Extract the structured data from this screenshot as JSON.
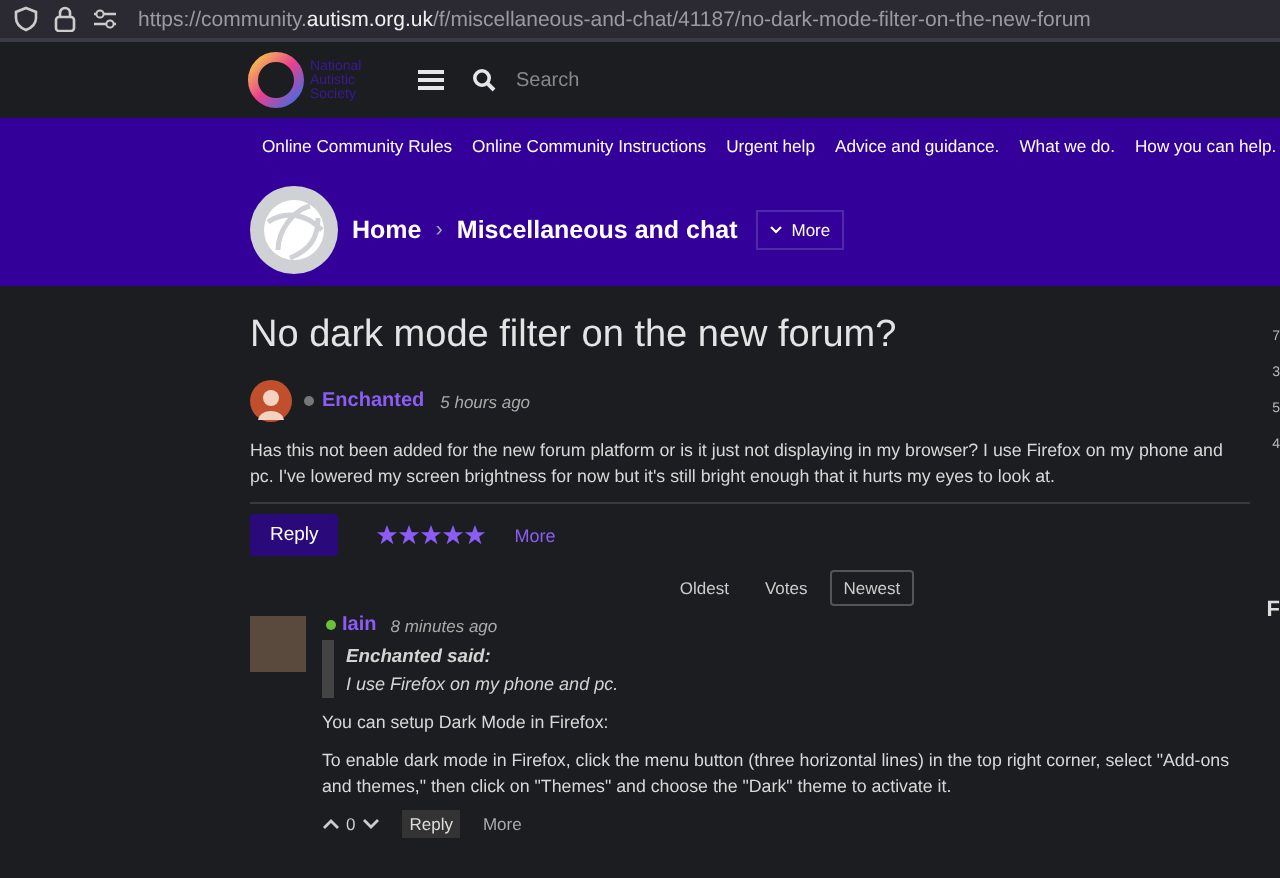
{
  "browser": {
    "url_prefix": "https://community.",
    "url_domain": "autism.org.uk",
    "url_path": "/f/miscellaneous-and-chat/41187/no-dark-mode-filter-on-the-new-forum"
  },
  "header": {
    "logo_text": "National Autistic Society",
    "search": {
      "placeholder": "Search"
    }
  },
  "nav": [
    "Online Community Rules",
    "Online Community Instructions",
    "Urgent help",
    "Advice and guidance.",
    "What we do.",
    "How you can help."
  ],
  "breadcrumb": {
    "items": [
      "Home",
      "Miscellaneous and chat"
    ],
    "separator": "›",
    "more": "More"
  },
  "post": {
    "title": "No dark mode filter on the new forum?",
    "author": "Enchanted",
    "online": false,
    "time": "5 hours ago",
    "body": "Has this not been added for the new forum platform or is it just not displaying in my browser? I use Firefox on my phone and pc. I've lowered my screen brightness for now but it's still bright enough that it hurts my eyes to look at.",
    "reply": "Reply",
    "stars": 5,
    "more": "More"
  },
  "sort_tabs": [
    {
      "label": "Oldest",
      "selected": false
    },
    {
      "label": "Votes",
      "selected": false
    },
    {
      "label": "Newest",
      "selected": true
    }
  ],
  "replies": [
    {
      "author": "Iain",
      "online": true,
      "time": "8 minutes ago",
      "quote_author": "Enchanted said:",
      "quote": "I use Firefox on my phone and pc.",
      "paragraphs": [
        "You can setup Dark Mode in Firefox:",
        "To enable dark mode in Firefox, click the menu button (three horizontal lines) in the top right corner, select \"Add-ons and themes,\" then click on \"Themes\" and choose the \"Dark\" theme to activate it."
      ],
      "votes": "0",
      "reply": "Reply",
      "more": "More"
    }
  ],
  "sidebar_fragments": [
    "7",
    "3",
    "5",
    "4",
    "F"
  ]
}
